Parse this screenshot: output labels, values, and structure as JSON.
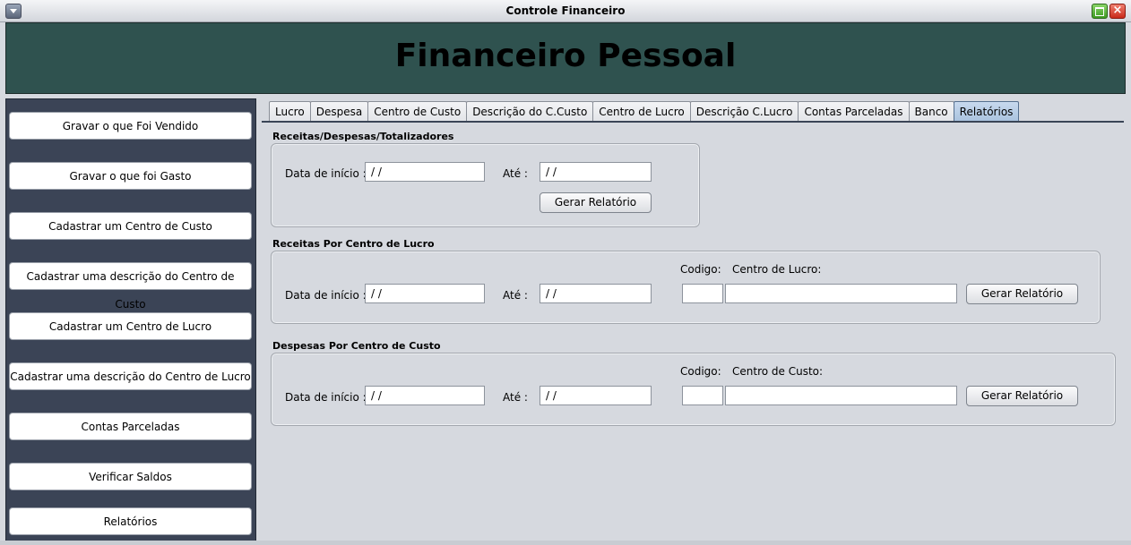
{
  "window": {
    "title": "Controle Financeiro"
  },
  "banner": {
    "title": "Financeiro Pessoal"
  },
  "sidebar": {
    "items": [
      {
        "label": "Gravar o que Foi Vendido"
      },
      {
        "label": "Gravar o que foi Gasto"
      },
      {
        "label": "Cadastrar um Centro de Custo"
      },
      {
        "label": "Cadastrar uma descrição do Centro de Custo"
      },
      {
        "label": "Cadastrar um Centro de Lucro"
      },
      {
        "label": "Cadastrar uma descrição do Centro de Lucro"
      },
      {
        "label": "Contas Parceladas"
      },
      {
        "label": "Verificar Saldos"
      },
      {
        "label": "Relatórios"
      }
    ]
  },
  "tabs": [
    {
      "label": "Lucro"
    },
    {
      "label": "Despesa"
    },
    {
      "label": "Centro de Custo"
    },
    {
      "label": "Descrição do C.Custo"
    },
    {
      "label": "Centro de Lucro"
    },
    {
      "label": "Descrição C.Lucro"
    },
    {
      "label": "Contas Parceladas"
    },
    {
      "label": "Banco"
    },
    {
      "label": "Relatórios",
      "active": true
    }
  ],
  "group1": {
    "title": "Receitas/Despesas/Totalizadores",
    "start_label": "Data de início :",
    "start_value": " /  /",
    "end_label": "Até :",
    "end_value": " /  /",
    "button": "Gerar Relatório"
  },
  "group2": {
    "title": "Receitas Por Centro de Lucro",
    "start_label": "Data de início :",
    "start_value": " /  /",
    "end_label": "Até :",
    "end_value": " /  /",
    "code_label": "Codigo:",
    "code_value": "",
    "center_label": "Centro de Lucro:",
    "center_value": "",
    "button": "Gerar Relatório"
  },
  "group3": {
    "title": "Despesas Por Centro de Custo",
    "start_label": "Data de início :",
    "start_value": " /  /",
    "end_label": "Até :",
    "end_value": " /  /",
    "code_label": "Codigo:",
    "code_value": "",
    "center_label": "Centro de Custo:",
    "center_value": "",
    "button": "Gerar Relatório"
  }
}
